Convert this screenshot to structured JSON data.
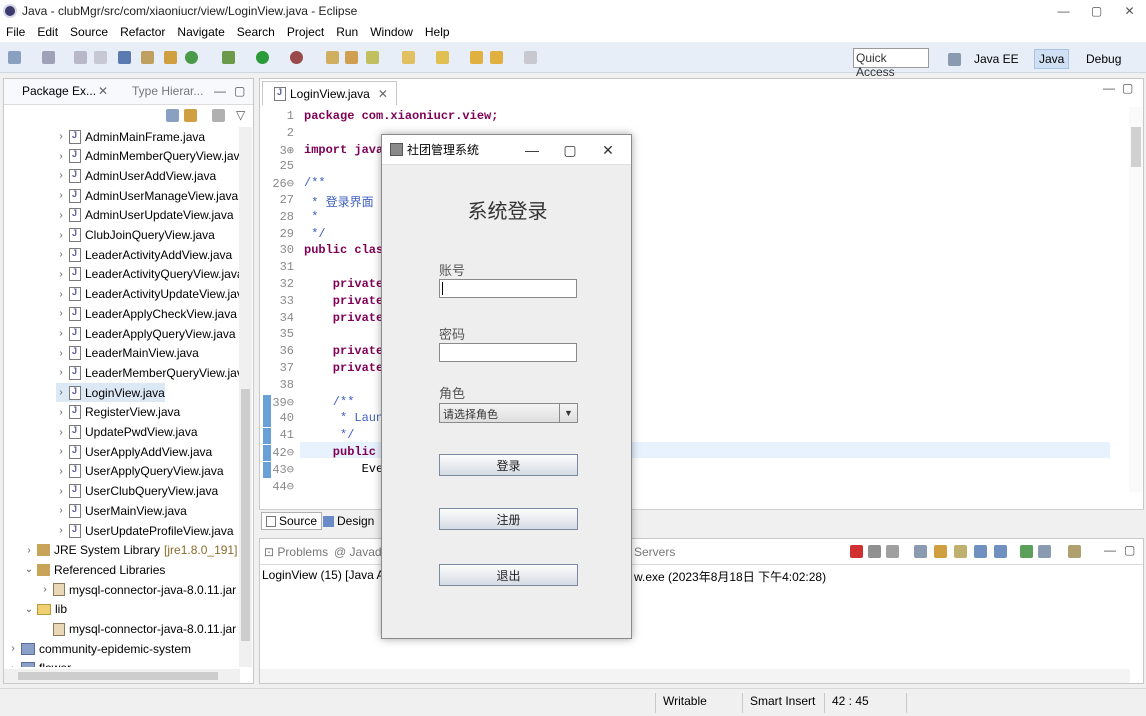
{
  "window": {
    "title": "Java - clubMgr/src/com/xiaoniucr/view/LoginView.java - Eclipse",
    "min": "—",
    "max": "▢",
    "close": "✕"
  },
  "menu": [
    "File",
    "Edit",
    "Source",
    "Refactor",
    "Navigate",
    "Search",
    "Project",
    "Run",
    "Window",
    "Help"
  ],
  "toolbar": {
    "quick_access": "Quick Access",
    "persp_javaee": "Java EE",
    "persp_java": "Java",
    "persp_debug": "Debug"
  },
  "left": {
    "tab1": "Package Ex...",
    "tab2": "Type Hierar...",
    "files": [
      "AdminMainFrame.java",
      "AdminMemberQueryView.java",
      "AdminUserAddView.java",
      "AdminUserManageView.java",
      "AdminUserUpdateView.java",
      "ClubJoinQueryView.java",
      "LeaderActivityAddView.java",
      "LeaderActivityQueryView.java",
      "LeaderActivityUpdateView.java",
      "LeaderApplyCheckView.java",
      "LeaderApplyQueryView.java",
      "LeaderMainView.java",
      "LeaderMemberQueryView.java",
      "LoginView.java",
      "RegisterView.java",
      "UpdatePwdView.java",
      "UserApplyAddView.java",
      "UserApplyQueryView.java",
      "UserClubQueryView.java",
      "UserMainView.java",
      "UserUpdateProfileView.java"
    ],
    "jre": "JRE System Library",
    "jre_version": "[jre1.8.0_191]",
    "reflibs": "Referenced Libraries",
    "jar1": "mysql-connector-java-8.0.11.jar",
    "lib": "lib",
    "jar2": "mysql-connector-java-8.0.11.jar",
    "proj1": "community-epidemic-system",
    "proj2": "flower"
  },
  "editor": {
    "tab": "LoginView.java",
    "lines": [
      {
        "n": "1",
        "t": "package com.xiaoniucr.view;"
      },
      {
        "n": "2",
        "t": ""
      },
      {
        "n": "3⊕",
        "t": "import java."
      },
      {
        "n": "25",
        "t": ""
      },
      {
        "n": "26⊖",
        "t": "/**"
      },
      {
        "n": "27",
        "t": " * 登录界面"
      },
      {
        "n": "28",
        "t": " *"
      },
      {
        "n": "29",
        "t": " */"
      },
      {
        "n": "30",
        "t": "public class"
      },
      {
        "n": "31",
        "t": ""
      },
      {
        "n": "32",
        "t": "    private"
      },
      {
        "n": "33",
        "t": "    private"
      },
      {
        "n": "34",
        "t": "    private"
      },
      {
        "n": "35",
        "t": ""
      },
      {
        "n": "36",
        "t": "    private"
      },
      {
        "n": "37",
        "t": "    private"
      },
      {
        "n": "38",
        "t": ""
      },
      {
        "n": "39⊖",
        "t": "    /**"
      },
      {
        "n": "40",
        "t": "     * Launc"
      },
      {
        "n": "41",
        "t": "     */"
      },
      {
        "n": "42⊖",
        "t": "    public s"
      },
      {
        "n": "43⊖",
        "t": "        Even"
      },
      {
        "n": "44⊖",
        "t": ""
      }
    ],
    "source_tab": "Source",
    "design_tab": "Design"
  },
  "console": {
    "tab_problems": "Problems",
    "tab_javadoc": "Javado",
    "tab_servers": "Servers",
    "line_left": "LoginView (15) [Java App",
    "line_right": "w.exe (2023年8月18日 下午4:02:28)"
  },
  "status": {
    "writable": "Writable",
    "insert": "Smart Insert",
    "pos": "42 : 45"
  },
  "dialog": {
    "title": "社团管理系统",
    "heading": "系统登录",
    "account_label": "账号",
    "password_label": "密码",
    "role_label": "角色",
    "role_placeholder": "请选择角色",
    "login": "登录",
    "register": "注册",
    "exit": "退出"
  }
}
